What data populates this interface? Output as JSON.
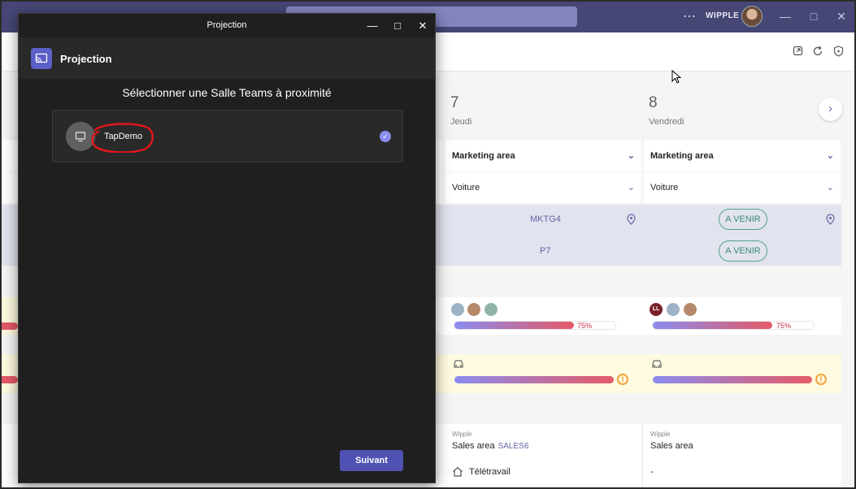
{
  "teams": {
    "org_name": "WIPPLE",
    "titlebar_dots": "⋯",
    "window_controls": {
      "minimize": "—",
      "maximize": "□",
      "close": "✕"
    },
    "days": [
      {
        "num": "7",
        "name": "Jeudi"
      },
      {
        "num": "8",
        "name": "Vendredi"
      }
    ],
    "next_icon": "›",
    "selects": {
      "area": "Marketing area",
      "transport": "Voiture",
      "chevron": "⌄"
    },
    "desks": {
      "jeudi_desk": "MKTG4",
      "jeudi_parking": "P7",
      "vendredi_status": "A VENIR"
    },
    "occupancy": {
      "jeudi_pct": "75%",
      "vendredi_pct": "75%"
    },
    "avatars_vendredi_initials": "LL",
    "bottom": {
      "org_label": "Wipple",
      "jeudi_location": "Sales area",
      "jeudi_desk": "SALES6",
      "vendredi_location": "Sales area",
      "jeudi_mode": "Télétravail",
      "vendredi_mode": "-"
    },
    "colors": {
      "brand": "#464775",
      "accent": "#6264a7",
      "status_green": "#55a28a",
      "warning": "#f2a23c"
    }
  },
  "dialog": {
    "window_title": "Projection",
    "controls": {
      "minimize": "—",
      "maximize": "□",
      "close": "✕"
    },
    "app_title": "Projection",
    "heading": "Sélectionner une Salle Teams à proximité",
    "rooms": [
      {
        "name": "TapDemo",
        "selected": true
      }
    ],
    "next_label": "Suivant"
  }
}
